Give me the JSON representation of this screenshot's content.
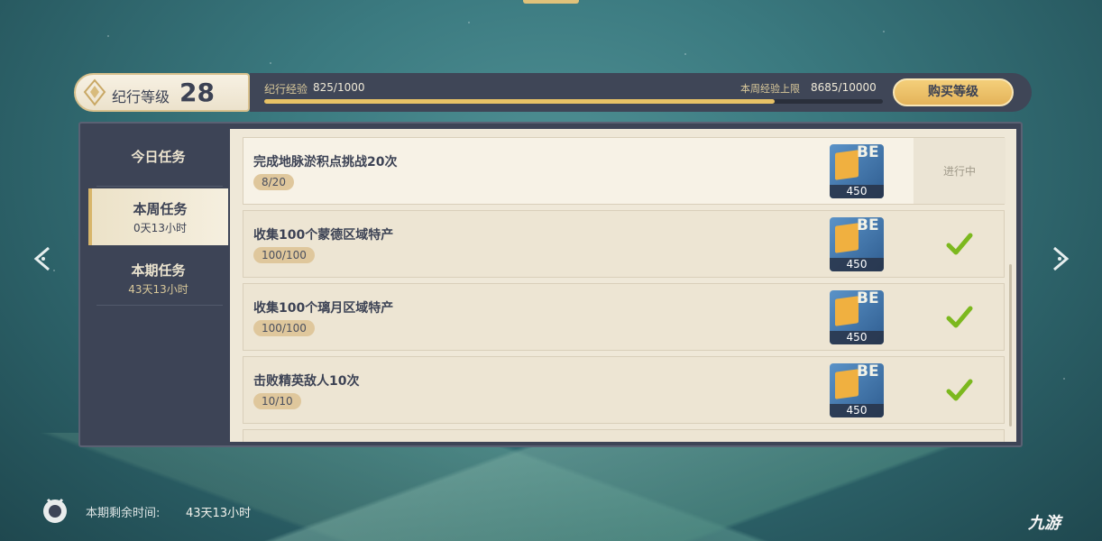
{
  "header": {
    "level_label": "纪行等级",
    "level_value": "28",
    "exp_label": "纪行经验",
    "exp_value": "825/1000",
    "exp_progress": 0.825,
    "weekly_cap_label": "本周经验上限",
    "weekly_cap_value": "8685/10000",
    "buy_button": "购买等级"
  },
  "tabs": [
    {
      "label": "今日任务",
      "sub": ""
    },
    {
      "label": "本周任务",
      "sub": "0天13小时"
    },
    {
      "label": "本期任务",
      "sub": "43天13小时"
    }
  ],
  "active_tab": 1,
  "missions": [
    {
      "title": "完成地脉淤积点挑战20次",
      "progress": "8/20",
      "reward": "450",
      "status": "进行中"
    },
    {
      "title": "收集100个蒙德区域特产",
      "progress": "100/100",
      "reward": "450",
      "status": "completed"
    },
    {
      "title": "收集100个璃月区域特产",
      "progress": "100/100",
      "reward": "450",
      "status": "completed"
    },
    {
      "title": "击败精英敌人10次",
      "progress": "10/10",
      "reward": "450",
      "status": "completed"
    }
  ],
  "reward_icon_letters": "BE",
  "footer": {
    "remaining_label": "本期剩余时间:",
    "remaining_value": "43天13小时"
  },
  "watermark": "九游",
  "colors": {
    "accent_gold": "#e8c266",
    "panel_dark": "#3d4456",
    "check_green": "#7cb81e"
  }
}
